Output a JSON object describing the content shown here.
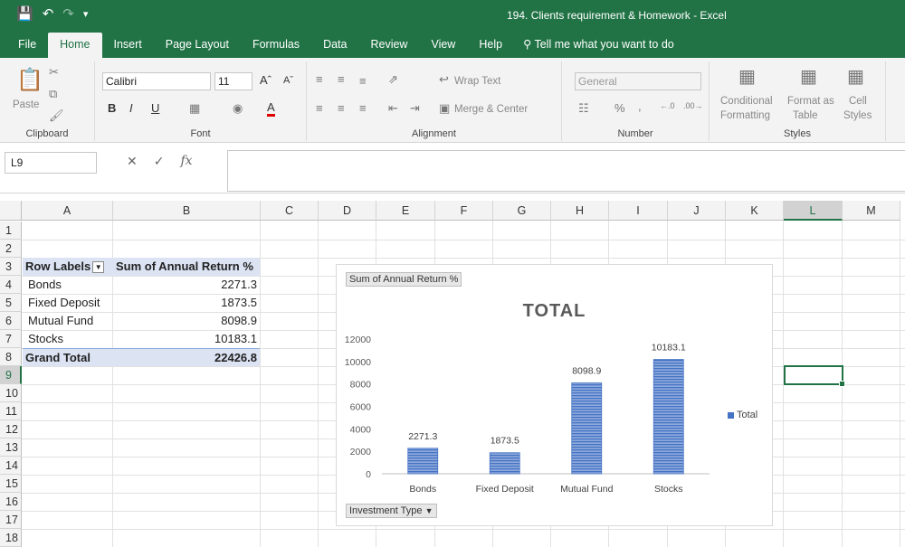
{
  "window": {
    "title": "194. Clients requirement & Homework  -  Excel"
  },
  "tabs": [
    "File",
    "Home",
    "Insert",
    "Page Layout",
    "Formulas",
    "Data",
    "Review",
    "View",
    "Help"
  ],
  "active_tab": "Home",
  "tell_me": "Tell me what you want to do",
  "ribbon": {
    "clipboard": {
      "paste": "Paste",
      "label": "Clipboard"
    },
    "font": {
      "name": "Calibri",
      "size": "11",
      "bold": "B",
      "italic": "I",
      "underline": "U",
      "label": "Font"
    },
    "alignment": {
      "wrap": "Wrap Text",
      "merge": "Merge & Center",
      "label": "Alignment"
    },
    "number": {
      "format": "General",
      "percent": "%",
      "comma": ",",
      "label": "Number"
    },
    "styles": {
      "conditional": "Conditional",
      "conditional2": "Formatting",
      "format_as": "Format as",
      "format_as2": "Table",
      "cell": "Cell",
      "cell2": "Styles",
      "label": "Styles"
    }
  },
  "formula_bar": {
    "name_box": "L9",
    "fx": "fx",
    "content": ""
  },
  "columns": [
    "A",
    "B",
    "C",
    "D",
    "E",
    "F",
    "G",
    "H",
    "I",
    "J",
    "K",
    "L",
    "M"
  ],
  "selected_column": "L",
  "rows": [
    "1",
    "2",
    "3",
    "4",
    "5",
    "6",
    "7",
    "8",
    "9",
    "10",
    "11",
    "12",
    "13",
    "14",
    "15",
    "16",
    "17",
    "18"
  ],
  "selected_row": "9",
  "pivot": {
    "header_label": "Row Labels",
    "header_value": "Sum of  Annual Return %",
    "rows": [
      {
        "label": "Bonds",
        "value": "2271.3"
      },
      {
        "label": "Fixed Deposit",
        "value": "1873.5"
      },
      {
        "label": "Mutual Fund",
        "value": "8098.9"
      },
      {
        "label": "Stocks",
        "value": "10183.1"
      }
    ],
    "total_label": "Grand Total",
    "total_value": "22426.8"
  },
  "chart": {
    "value_field_button": "Sum of  Annual Return %",
    "axis_field_button": "Investment Type",
    "legend": "Total"
  },
  "chart_data": {
    "type": "bar",
    "title": "TOTAL",
    "categories": [
      "Bonds",
      "Fixed Deposit",
      "Mutual Fund",
      "Stocks"
    ],
    "series": [
      {
        "name": "Total",
        "values": [
          2271.3,
          1873.5,
          8098.9,
          10183.1
        ]
      }
    ],
    "data_labels": [
      "2271.3",
      "1873.5",
      "8098.9",
      "10183.1"
    ],
    "y_ticks": [
      "0",
      "2000",
      "4000",
      "6000",
      "8000",
      "10000",
      "12000"
    ],
    "ylim": [
      0,
      12000
    ],
    "grid": false,
    "legend_position": "right",
    "bar_color": "#4472c4"
  }
}
